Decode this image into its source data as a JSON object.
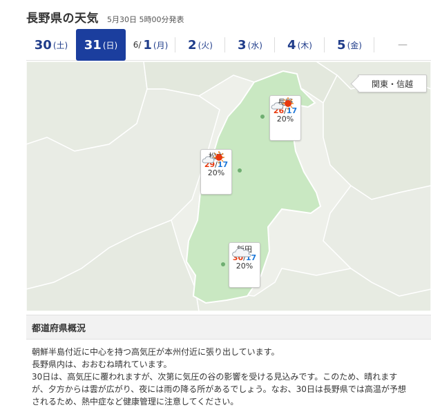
{
  "header": {
    "title": "長野県の天気",
    "published": "5月30日 5時00分発表"
  },
  "tabs": [
    {
      "month": "",
      "day": "30",
      "dow": "(土)",
      "active": false
    },
    {
      "month": "",
      "day": "31",
      "dow": "(日)",
      "active": true
    },
    {
      "month": "6/",
      "day": "1",
      "dow": "(月)",
      "active": false
    },
    {
      "month": "",
      "day": "2",
      "dow": "(火)",
      "active": false
    },
    {
      "month": "",
      "day": "3",
      "dow": "(水)",
      "active": false
    },
    {
      "month": "",
      "day": "4",
      "dow": "(木)",
      "active": false
    },
    {
      "month": "",
      "day": "5",
      "dow": "(金)",
      "active": false
    },
    {
      "month": "",
      "day": "",
      "dow": "",
      "dash": "—",
      "active": false
    }
  ],
  "map": {
    "region_button": "関東・信越",
    "colors": {
      "prefecture": "#c9e8c2",
      "land": "#e8ebe4",
      "border": "#ffffff",
      "dot": "#6fae71"
    },
    "cities": [
      {
        "name": "長野",
        "weather_icon": "cloud-sun-icon",
        "max": "26",
        "min": "17",
        "pop": "20%"
      },
      {
        "name": "松本",
        "weather_icon": "cloud-sun-icon",
        "max": "29",
        "min": "17",
        "pop": "20%"
      },
      {
        "name": "飯田",
        "weather_icon": "cloud-icon",
        "max": "30",
        "min": "17",
        "pop": "20%"
      }
    ]
  },
  "overview": {
    "title": "都道府県概況",
    "lines": [
      "朝鮮半島付近に中心を持つ高気圧が本州付近に張り出しています。",
      "長野県内は、おおむね晴れています。",
      "30日は、高気圧に覆われますが、次第に気圧の谷の影響を受ける見込みです。このため、晴れます",
      "が、夕方からは雲が広がり、夜には雨の降る所があるでしょう。なお、30日は長野県では高温が予想",
      "されるため、熱中症など健康管理に注意してください。"
    ]
  }
}
